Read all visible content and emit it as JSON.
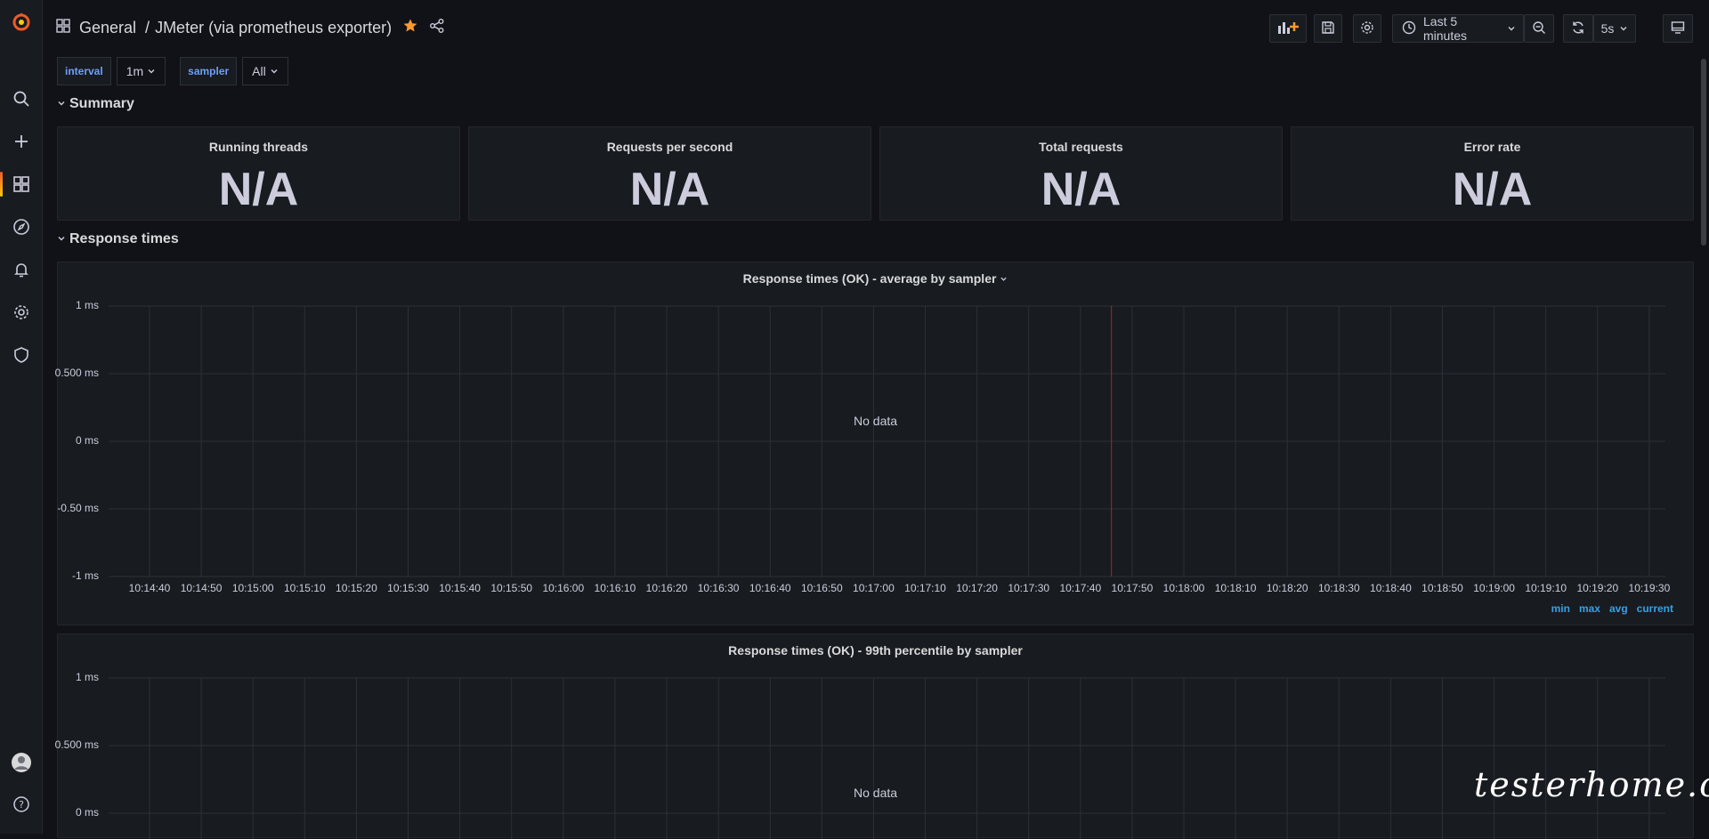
{
  "breadcrumb": {
    "folder": "General",
    "separator": "/",
    "dashboard": "JMeter (via prometheus exporter)"
  },
  "toolbar": {
    "time_range": "Last 5 minutes",
    "refresh_interval": "5s"
  },
  "variables": [
    {
      "label": "interval",
      "value": "1m"
    },
    {
      "label": "sampler",
      "value": "All"
    }
  ],
  "rows": {
    "summary": "Summary",
    "response_times": "Response times"
  },
  "stats": [
    {
      "title": "Running threads",
      "value": "N/A"
    },
    {
      "title": "Requests per second",
      "value": "N/A"
    },
    {
      "title": "Total requests",
      "value": "N/A"
    },
    {
      "title": "Error rate",
      "value": "N/A"
    }
  ],
  "graphs": [
    {
      "title": "Response times (OK) - average by sampler",
      "no_data": "No data",
      "y_ticks": [
        "1 ms",
        "0.500 ms",
        "0 ms",
        "-0.50 ms",
        "-1 ms"
      ],
      "legend": [
        "min",
        "max",
        "avg",
        "current"
      ]
    },
    {
      "title": "Response times (OK) - 99th percentile by sampler",
      "no_data": "No data",
      "y_ticks": [
        "1 ms",
        "0.500 ms",
        "0 ms"
      ]
    }
  ],
  "chart_data": {
    "type": "line",
    "x_ticks": [
      "10:14:40",
      "10:14:50",
      "10:15:00",
      "10:15:10",
      "10:15:20",
      "10:15:30",
      "10:15:40",
      "10:15:50",
      "10:16:00",
      "10:16:10",
      "10:16:20",
      "10:16:30",
      "10:16:40",
      "10:16:50",
      "10:17:00",
      "10:17:10",
      "10:17:20",
      "10:17:30",
      "10:17:40",
      "10:17:50",
      "10:18:00",
      "10:18:10",
      "10:18:20",
      "10:18:30",
      "10:18:40",
      "10:18:50",
      "10:19:00",
      "10:19:10",
      "10:19:20",
      "10:19:30"
    ],
    "series": [],
    "ylim": [
      -1,
      1
    ],
    "grid": true
  },
  "colors": {
    "accent": "#33a2e5",
    "star": "#ff9830",
    "now_marker": "#c4162a"
  },
  "icons": [
    "grafana-logo-icon",
    "search-icon",
    "plus-icon",
    "dashboards-icon",
    "explore-icon",
    "alerting-icon",
    "settings-icon",
    "shield-icon",
    "avatar-icon",
    "help-icon",
    "grid-icon",
    "star-icon",
    "share-icon",
    "add-panel-icon",
    "save-icon",
    "gear-icon",
    "clock-icon",
    "zoom-out-icon",
    "refresh-icon",
    "tv-icon"
  ],
  "watermark": "testerhome.com"
}
